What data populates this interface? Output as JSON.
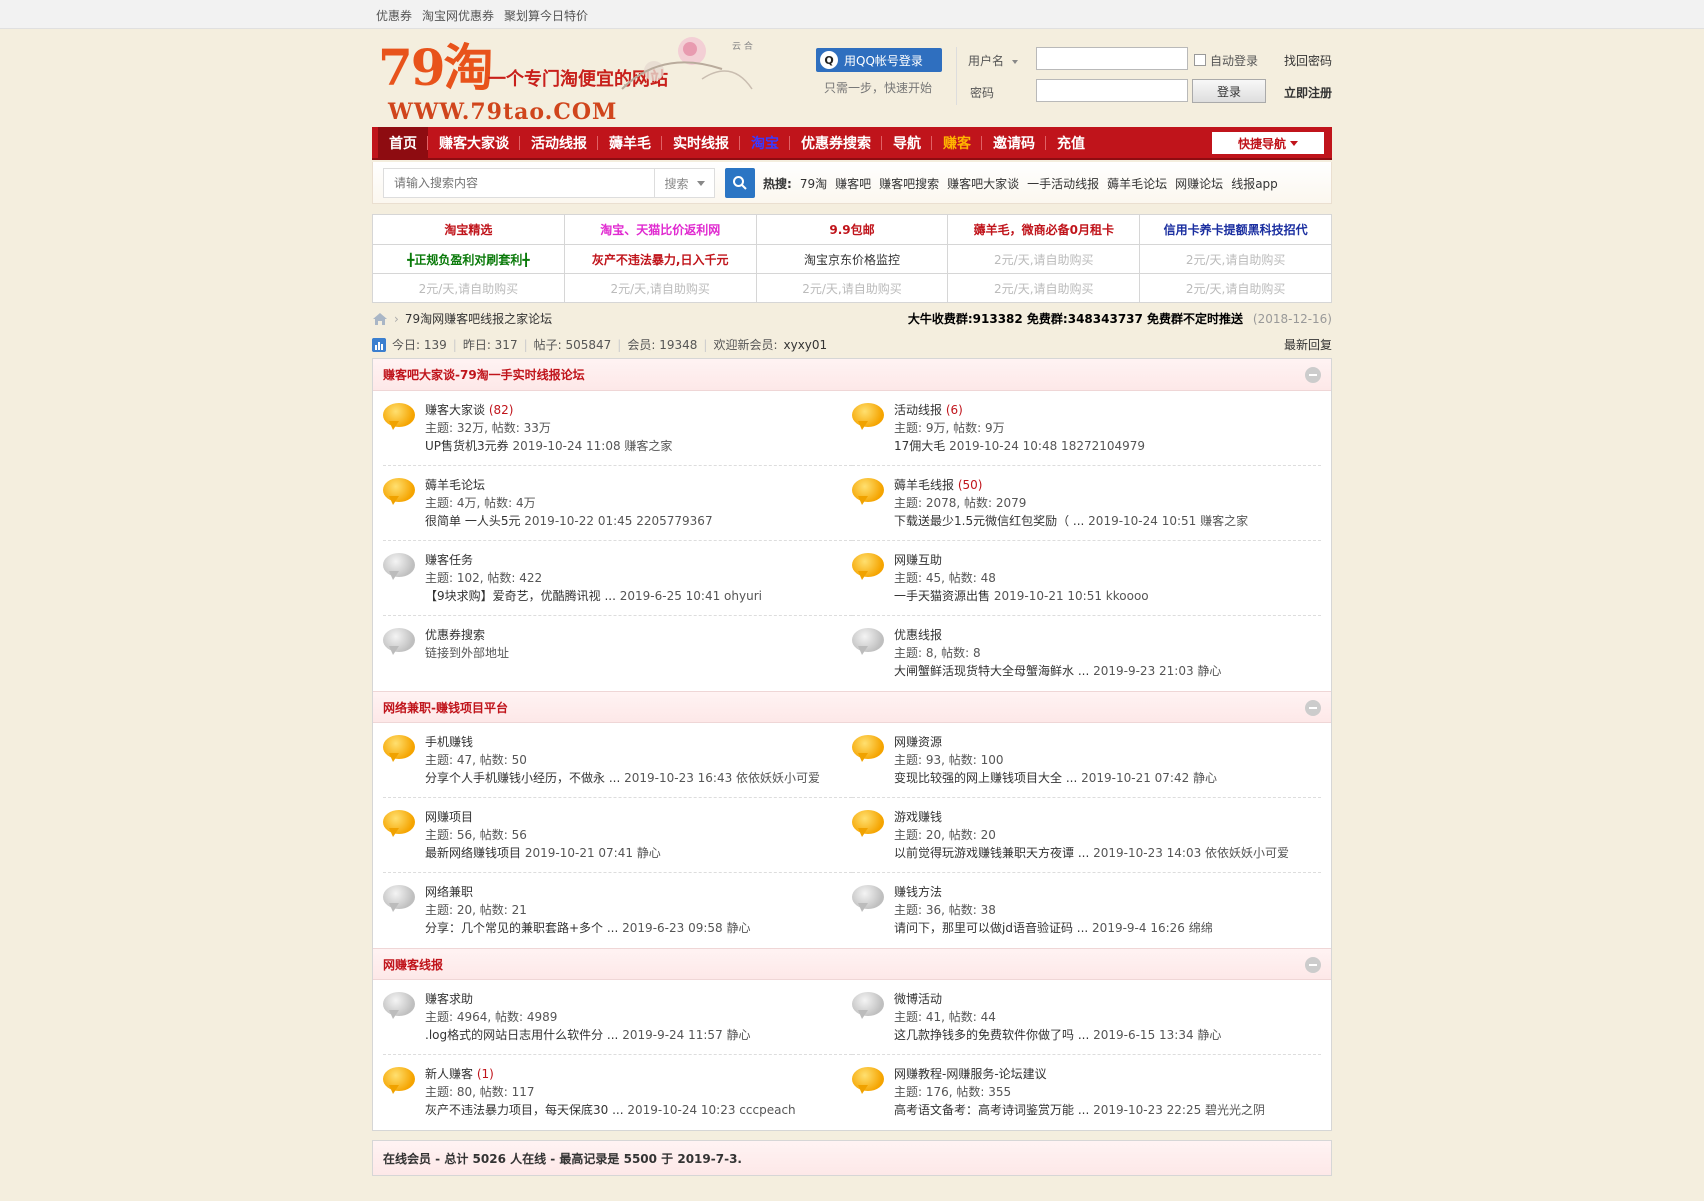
{
  "topbar": [
    "优惠券",
    "淘宝网优惠券",
    "聚划算今日特价"
  ],
  "logo": {
    "num": "79淘",
    "slogan": "一个专门淘便宜的网站",
    "url": "WWW.79tao.COM"
  },
  "login": {
    "qq_label": "用QQ帐号登录",
    "qq_sub": "只需一步，快速开始",
    "username_label": "用户名",
    "password_label": "密码",
    "auto_login": "自动登录",
    "forgot": "找回密码",
    "login_btn": "登录",
    "register": "立即注册"
  },
  "nav": {
    "items": [
      "首页",
      "赚客大家谈",
      "活动线报",
      "薅羊毛",
      "实时线报",
      "淘宝",
      "优惠券搜索",
      "导航",
      "赚客",
      "邀请码",
      "充值"
    ],
    "quick": "快捷导航"
  },
  "search": {
    "placeholder": "请输入搜索内容",
    "select": "搜索",
    "hot_label": "热搜:",
    "hot": [
      "79淘",
      "赚客吧",
      "赚客吧搜索",
      "赚客吧大家谈",
      "一手活动线报",
      "薅羊毛论坛",
      "网赚论坛",
      "线报app"
    ]
  },
  "ads": [
    [
      {
        "t": "淘宝精选",
        "c": "#c0141b"
      },
      {
        "t": "淘宝、天猫比价返利网",
        "c": "#e02ad0"
      },
      {
        "t": "9.9包邮",
        "c": "#c0141b"
      },
      {
        "t": "薅羊毛，微商必备0月租卡",
        "c": "#c0141b"
      },
      {
        "t": "信用卡养卡提额黑科技招代",
        "c": "#1b2fa0"
      }
    ],
    [
      {
        "t": "╋正规负盈利对刷套利╋",
        "c": "#0a7a0a"
      },
      {
        "t": "灰产不违法暴力,日入千元",
        "c": "#c0141b"
      },
      {
        "t": "淘宝京东价格监控",
        "c": "#333333"
      },
      {
        "t": "2元/天,请自助购买",
        "c": "#bbbbbb"
      },
      {
        "t": "2元/天,请自助购买",
        "c": "#bbbbbb"
      }
    ],
    [
      {
        "t": "2元/天,请自助购买",
        "c": "#bbbbbb"
      },
      {
        "t": "2元/天,请自助购买",
        "c": "#bbbbbb"
      },
      {
        "t": "2元/天,请自助购买",
        "c": "#bbbbbb"
      },
      {
        "t": "2元/天,请自助购买",
        "c": "#bbbbbb"
      },
      {
        "t": "2元/天,请自助购买",
        "c": "#bbbbbb"
      }
    ]
  ],
  "crumb": {
    "title": "79淘网赚客吧线报之家论坛",
    "qun": "大牛收费群:913382 免费群:348343737 免费群不定时推送",
    "date": "(2018-12-16)"
  },
  "stats": {
    "today": "今日: 139",
    "yesterday": "昨日: 317",
    "posts": "帖子: 505847",
    "members": "会员: 19348",
    "welcome": "欢迎新会员:",
    "new_member": "xyxy01",
    "latest": "最新回复"
  },
  "sections": [
    {
      "title": "赚客吧大家谈-79淘一手实时线报论坛",
      "forums": [
        {
          "name": "赚客大家谈",
          "cnt": "(82)",
          "icon": "yellow",
          "stat": "主题: 32万, 帖数: 33万",
          "last": "UP售货机3元券",
          "time": "2019-10-24 11:08 赚客之家"
        },
        {
          "name": "活动线报",
          "cnt": "(6)",
          "icon": "yellow",
          "stat": "主题: 9万, 帖数: 9万",
          "last": "17佣大毛",
          "time": "2019-10-24 10:48 18272104979"
        },
        {
          "name": "薅羊毛论坛",
          "cnt": "",
          "icon": "yellow",
          "stat": "主题: 4万, 帖数: 4万",
          "last": "很简单 一人头5元",
          "time": "2019-10-22 01:45 2205779367"
        },
        {
          "name": "薅羊毛线报",
          "cnt": "(50)",
          "icon": "yellow",
          "stat": "主题: 2078, 帖数: 2079",
          "last": "下载送最少1.5元微信红包奖励（ ...",
          "time": "2019-10-24 10:51 赚客之家"
        },
        {
          "name": "赚客任务",
          "cnt": "",
          "icon": "gray",
          "stat": "主题: 102, 帖数: 422",
          "last": "【9块求购】爱奇艺，优酷腾讯视 ...",
          "time": "2019-6-25 10:41 ohyuri"
        },
        {
          "name": "网赚互助",
          "cnt": "",
          "icon": "yellow",
          "stat": "主题: 45, 帖数: 48",
          "last": "一手天猫资源出售",
          "time": "2019-10-21 10:51 kkoooo"
        },
        {
          "name": "优惠券搜索",
          "cnt": "",
          "icon": "gray",
          "stat": "链接到外部地址",
          "last": "",
          "time": ""
        },
        {
          "name": "优惠线报",
          "cnt": "",
          "icon": "gray",
          "stat": "主题: 8, 帖数: 8",
          "last": "大闸蟹鲜活现货特大全母蟹海鲜水 ...",
          "time": "2019-9-23 21:03 静心"
        }
      ]
    },
    {
      "title": "网络兼职-赚钱项目平台",
      "forums": [
        {
          "name": "手机赚钱",
          "cnt": "",
          "icon": "yellow",
          "stat": "主题: 47, 帖数: 50",
          "last": "分享个人手机赚钱小经历，不做永 ...",
          "time": "2019-10-23 16:43 依依妖妖小可爱"
        },
        {
          "name": "网赚资源",
          "cnt": "",
          "icon": "yellow",
          "stat": "主题: 93, 帖数: 100",
          "last": "变现比较强的网上赚钱项目大全 ...",
          "time": "2019-10-21 07:42 静心"
        },
        {
          "name": "网赚项目",
          "cnt": "",
          "icon": "yellow",
          "stat": "主题: 56, 帖数: 56",
          "last": "最新网络赚钱项目",
          "time": "2019-10-21 07:41 静心"
        },
        {
          "name": "游戏赚钱",
          "cnt": "",
          "icon": "yellow",
          "stat": "主题: 20, 帖数: 20",
          "last": "以前觉得玩游戏赚钱兼职天方夜谭 ...",
          "time": "2019-10-23 14:03 依依妖妖小可爱"
        },
        {
          "name": "网络兼职",
          "cnt": "",
          "icon": "gray",
          "stat": "主题: 20, 帖数: 21",
          "last": "分享：几个常见的兼职套路+多个 ...",
          "time": "2019-6-23 09:58 静心"
        },
        {
          "name": "赚钱方法",
          "cnt": "",
          "icon": "gray",
          "stat": "主题: 36, 帖数: 38",
          "last": "请问下，那里可以做jd语音验证码 ...",
          "time": "2019-9-4 16:26 绵绵"
        }
      ]
    },
    {
      "title": "网赚客线报",
      "forums": [
        {
          "name": "赚客求助",
          "cnt": "",
          "icon": "gray",
          "stat": "主题: 4964, 帖数: 4989",
          "last": ".log格式的网站日志用什么软件分 ...",
          "time": "2019-9-24 11:57 静心"
        },
        {
          "name": "微博活动",
          "cnt": "",
          "icon": "gray",
          "stat": "主题: 41, 帖数: 44",
          "last": "这几款挣钱多的免费软件你做了吗 ...",
          "time": "2019-6-15 13:34 静心"
        },
        {
          "name": "新人赚客",
          "cnt": "(1)",
          "icon": "yellow",
          "stat": "主题: 80, 帖数: 117",
          "last": "灰产不违法暴力项目，每天保底30 ...",
          "time": "2019-10-24 10:23 cccpeach"
        },
        {
          "name": "网赚教程-网赚服务-论坛建议",
          "cnt": "",
          "icon": "yellow",
          "stat": "主题: 176, 帖数: 355",
          "last": "高考语文备考：高考诗词鉴赏万能 ...",
          "time": "2019-10-23 22:25 碧光光之阴"
        }
      ]
    }
  ],
  "online": "在线会员 - 总计 5026 人在线 - 最高记录是 5500 于 2019-7-3."
}
